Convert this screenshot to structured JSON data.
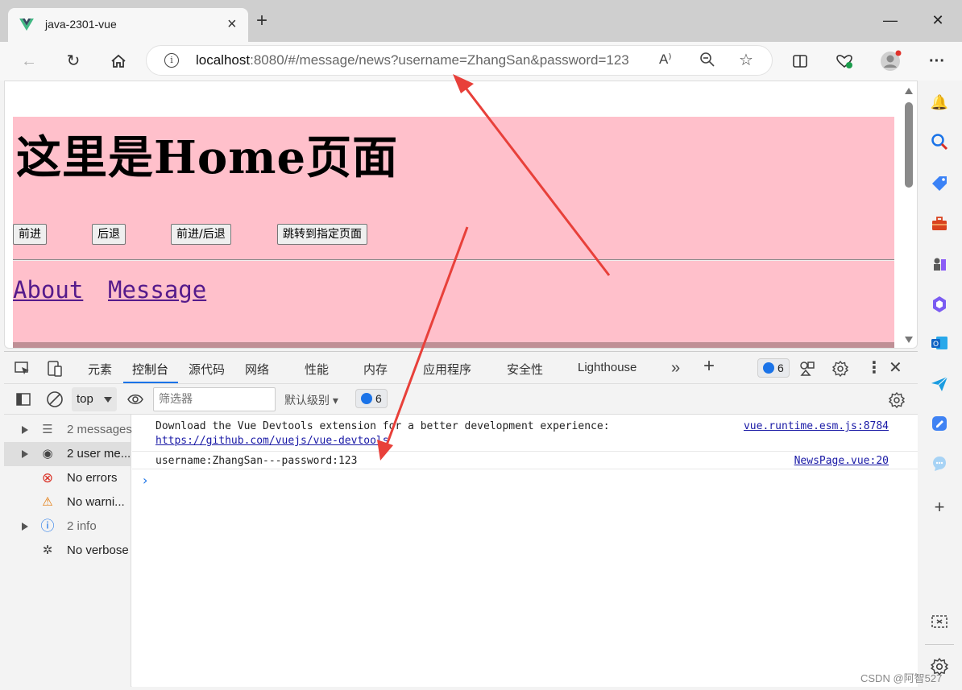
{
  "browser": {
    "tab_title": "java-2301-vue",
    "tab_close": "×",
    "new_tab": "+",
    "window_controls": {
      "minimize": "—",
      "maximize": "☐",
      "close": "✕"
    },
    "address_host": "localhost",
    "address_rest": ":8080/#/message/news?username=ZhangSan&password=123",
    "menu": "···"
  },
  "page": {
    "title": "这里是Home页面",
    "buttons": [
      "前进",
      "后退",
      "前进/后退",
      "跳转到指定页面"
    ],
    "links": [
      "About",
      "Message"
    ]
  },
  "devtools": {
    "tabs": [
      "元素",
      "控制台",
      "源代码",
      "网络",
      "性能",
      "内存",
      "应用程序",
      "安全性",
      "Lighthouse"
    ],
    "active_tab": "控制台",
    "issues_count": "6",
    "context": "top",
    "filter_placeholder": "筛选器",
    "level": "默认级别",
    "level_count": "6",
    "sidebar": [
      {
        "label": "2 messages",
        "icon": "list-icon",
        "expandable": true,
        "muted": true
      },
      {
        "label": "2 user me...",
        "icon": "user-icon",
        "expandable": true,
        "muted": false,
        "selected": true
      },
      {
        "label": "No errors",
        "icon": "error-icon",
        "expandable": false,
        "muted": false
      },
      {
        "label": "No warni...",
        "icon": "warning-icon",
        "expandable": false,
        "muted": false
      },
      {
        "label": "2 info",
        "icon": "info-icon",
        "expandable": true,
        "muted": true
      },
      {
        "label": "No verbose",
        "icon": "bug-icon",
        "expandable": false,
        "muted": false
      }
    ],
    "messages": [
      {
        "text": "Download the Vue Devtools extension for a better development experience:",
        "link": "https://github.com/vuejs/vue-devtools",
        "source": "vue.runtime.esm.js:8784"
      },
      {
        "text": "username:ZhangSan---password:123",
        "source": "NewsPage.vue:20"
      }
    ]
  },
  "watermark": "CSDN @阿智527",
  "colors": {
    "page_bg": "#ffc0cb",
    "link": "#551a8b",
    "accent": "#1a73e8",
    "arrow": "#e8403a"
  }
}
